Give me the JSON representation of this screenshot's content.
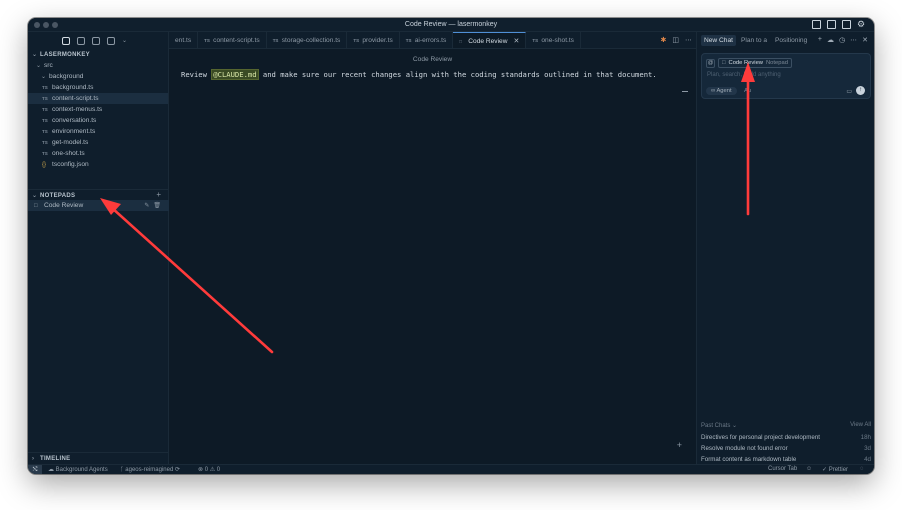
{
  "window": {
    "title": "Code Review — lasermonkey"
  },
  "sidebar": {
    "project": "LASERMONKEY",
    "folders": {
      "src": "src",
      "background": "background"
    },
    "files": [
      {
        "name": "background.ts",
        "badge": "TS"
      },
      {
        "name": "content-script.ts",
        "badge": "TS",
        "selected": true
      },
      {
        "name": "context-menus.ts",
        "badge": "TS"
      },
      {
        "name": "conversation.ts",
        "badge": "TS"
      },
      {
        "name": "environment.ts",
        "badge": "TS"
      },
      {
        "name": "get-model.ts",
        "badge": "TS"
      },
      {
        "name": "one-shot.ts",
        "badge": "TS"
      },
      {
        "name": "tsconfig.json",
        "badge": "{}"
      }
    ],
    "notepads_header": "NOTEPADS",
    "notepad_item": "Code Review",
    "timeline_header": "TIMELINE"
  },
  "tabs": [
    {
      "label": "ent.ts",
      "badge": ""
    },
    {
      "label": "content-script.ts",
      "badge": "TS"
    },
    {
      "label": "storage-collection.ts",
      "badge": "TS"
    },
    {
      "label": "provider.ts",
      "badge": "TS"
    },
    {
      "label": "ai-errors.ts",
      "badge": "TS"
    },
    {
      "label": "Code Review",
      "badge": "□",
      "active": true
    },
    {
      "label": "one-shot.ts",
      "badge": "TS"
    }
  ],
  "editor": {
    "title": "Code Review",
    "text_before": "Review ",
    "mention": "@CLAUDE.md",
    "text_after": " and make sure our recent changes align with the coding standards outlined in that document."
  },
  "chat": {
    "tabs": [
      "New Chat",
      "Plan to a",
      "Positioning"
    ],
    "context_chip": "Code Review",
    "context_sub": "Notepad",
    "placeholder": "Plan, search, build anything",
    "mode": "Agent",
    "model": "Au",
    "past_chats_label": "Past Chats",
    "view_all": "View All",
    "past_chats": [
      {
        "title": "Directives for personal project development",
        "age": "18h"
      },
      {
        "title": "Resolve module not found error",
        "age": "3d"
      },
      {
        "title": "Format content as markdown table",
        "age": "4d"
      }
    ]
  },
  "status": {
    "background_agents": "Background Agents",
    "branch": "ageos-reimagined",
    "problems": "⊗ 0 ⚠ 0",
    "cursor_tab": "Cursor Tab",
    "prettier": "Prettier"
  },
  "colors": {
    "annotation_arrow": "#ff3b3b",
    "accent": "#4f8fd6",
    "mention_bg": "#3a4a24"
  }
}
